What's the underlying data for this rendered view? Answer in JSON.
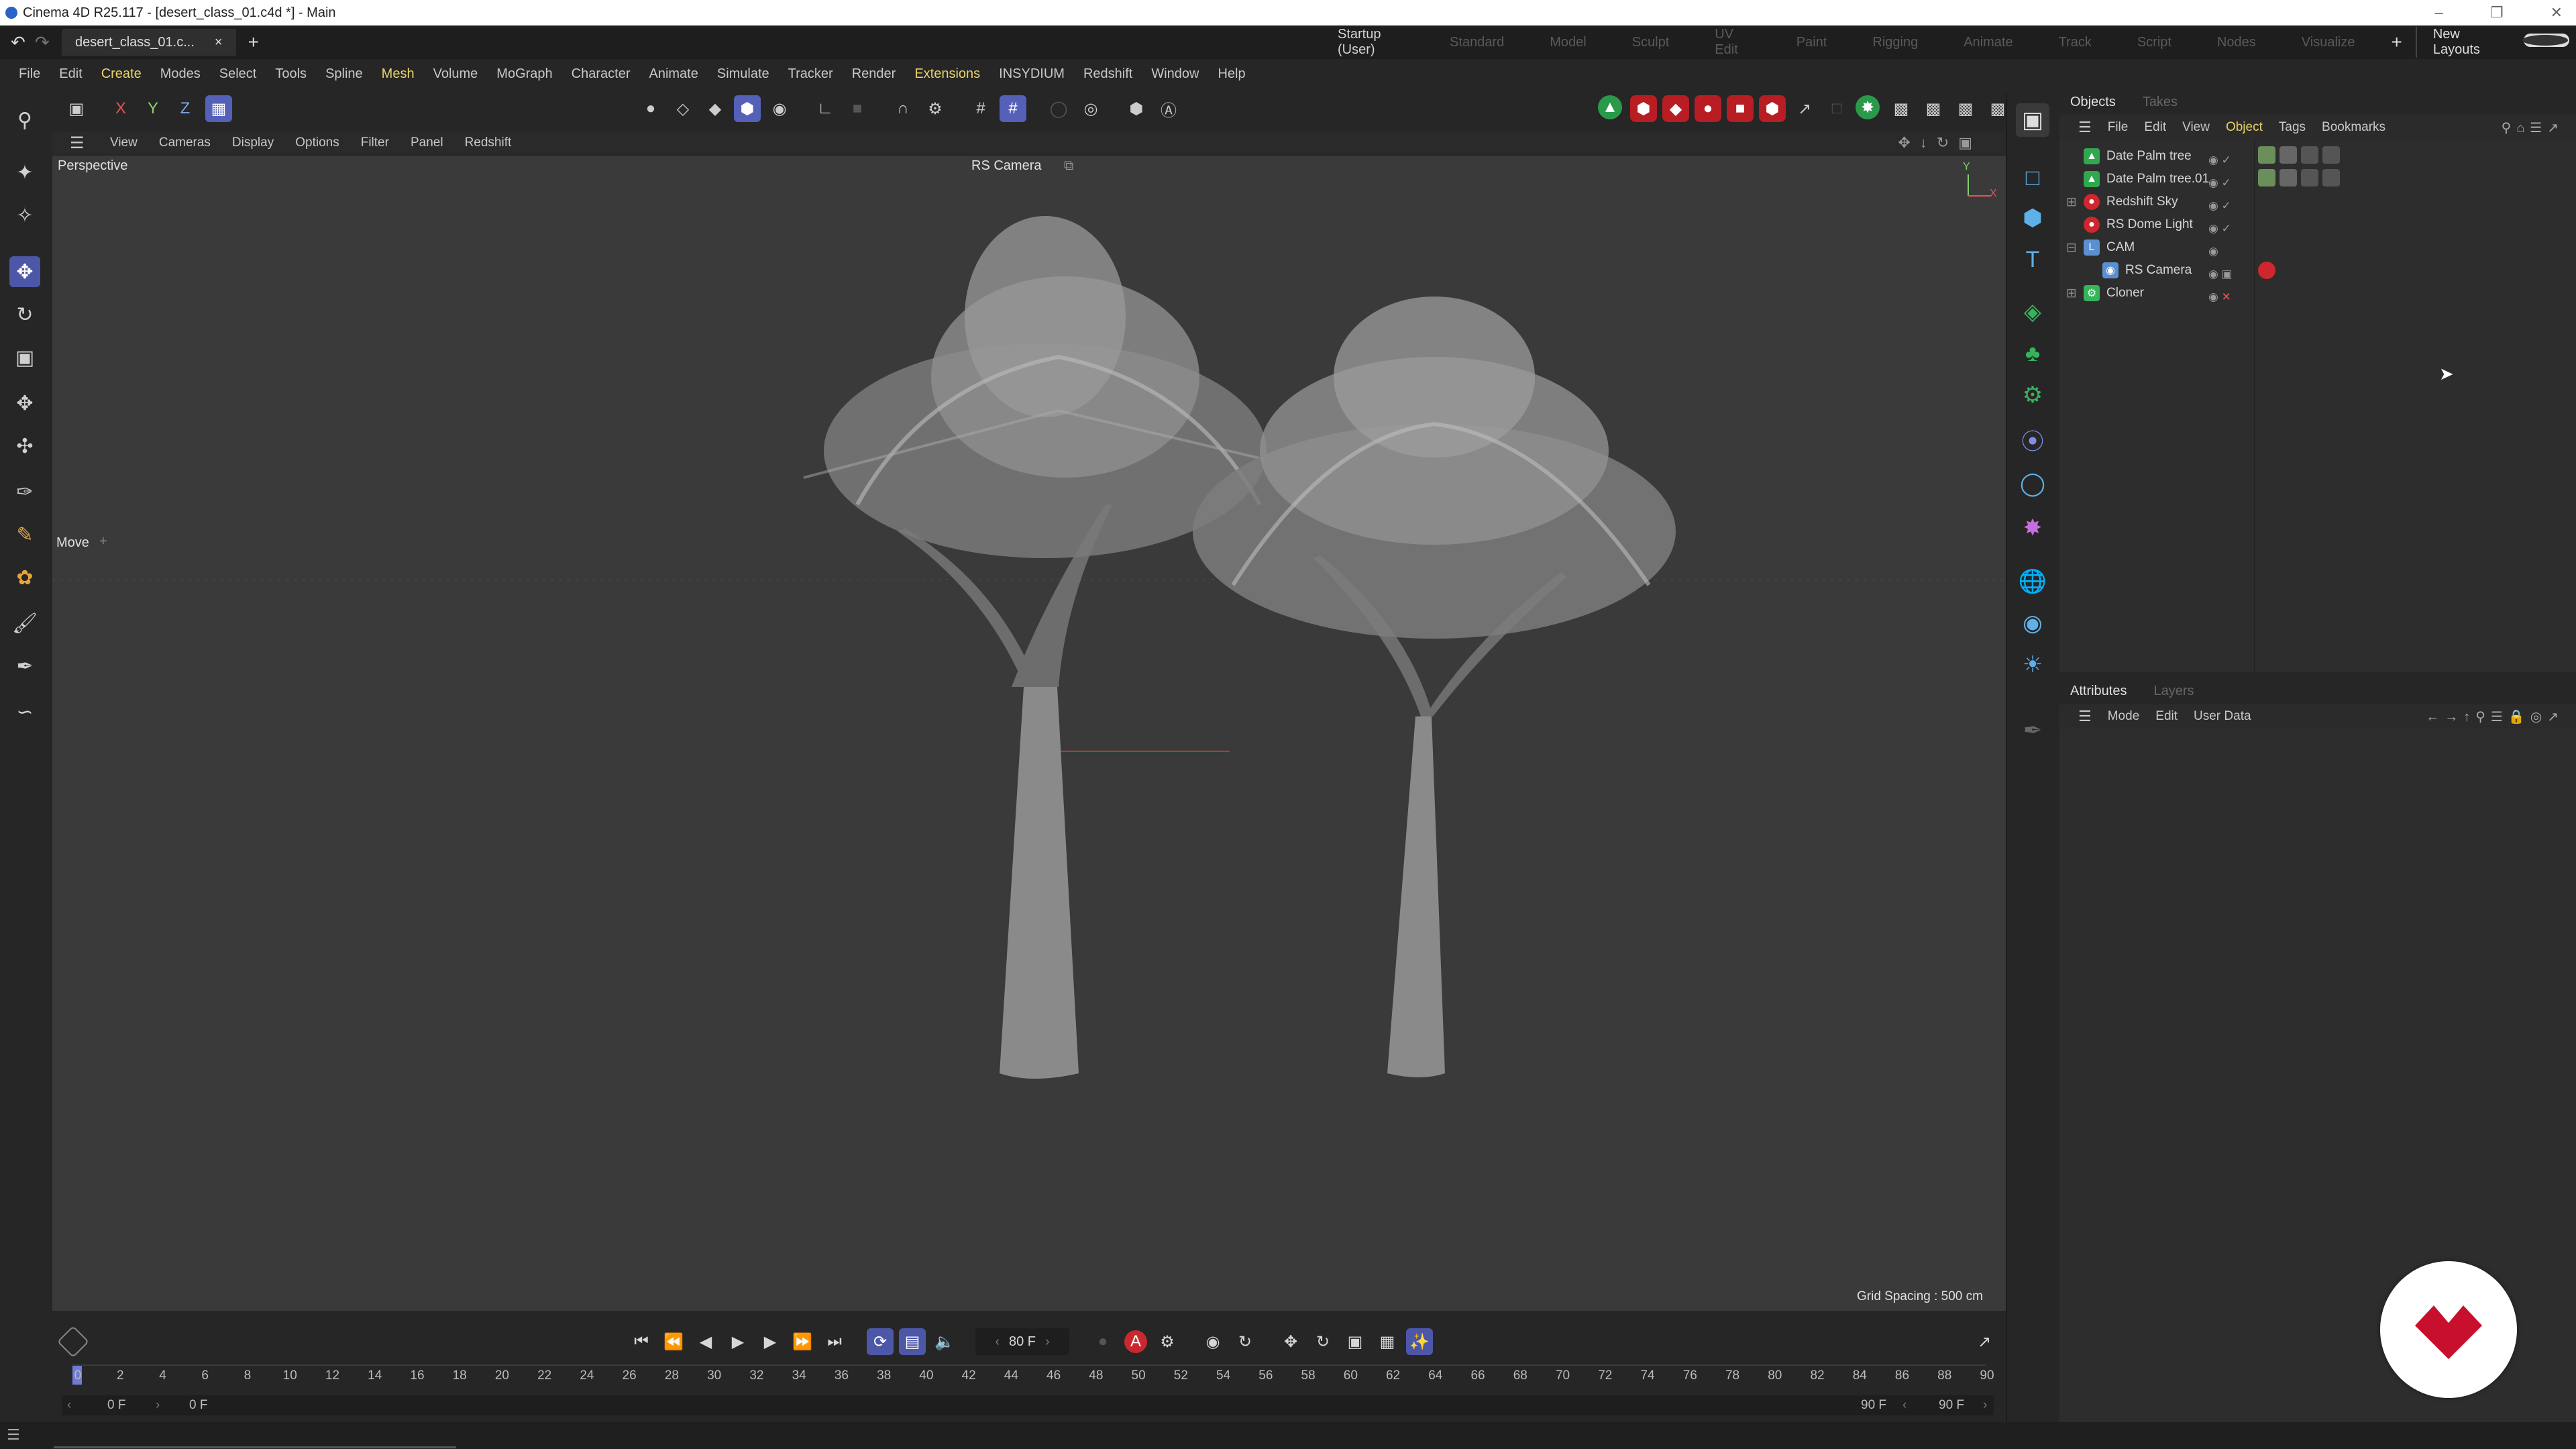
{
  "window": {
    "title": "Cinema 4D R25.117 - [desert_class_01.c4d *] - Main"
  },
  "tabs": {
    "doc_tab": "desert_class_01.c...",
    "close": "×",
    "add": "+"
  },
  "layouts": {
    "items": [
      "Startup (User)",
      "Standard",
      "Model",
      "Sculpt",
      "UV Edit",
      "Paint",
      "Rigging",
      "Animate",
      "Track",
      "Script",
      "Nodes",
      "Visualize"
    ],
    "new_layouts": "New Layouts"
  },
  "menu": [
    "File",
    "Edit",
    "Create",
    "Modes",
    "Select",
    "Tools",
    "Spline",
    "Mesh",
    "Volume",
    "MoGraph",
    "Character",
    "Animate",
    "Simulate",
    "Tracker",
    "Render",
    "Extensions",
    "INSYDIUM",
    "Redshift",
    "Window",
    "Help"
  ],
  "toolbar": {
    "x": "X",
    "y": "Y",
    "z": "Z"
  },
  "viewport_menu": [
    "View",
    "Cameras",
    "Display",
    "Options",
    "Filter",
    "Panel",
    "Redshift"
  ],
  "viewport": {
    "label": "Perspective",
    "camera": "RS Camera",
    "tool": "Move",
    "grid_spacing": "Grid Spacing : 500 cm",
    "axis_y": "Y",
    "axis_x": "X"
  },
  "objects_panel": {
    "tabs": [
      "Objects",
      "Takes"
    ],
    "menu": [
      "File",
      "Edit",
      "View",
      "Object",
      "Tags",
      "Bookmarks"
    ],
    "items": [
      {
        "name": "Date Palm tree",
        "icon": "tree-icon",
        "color": "#2fa84f"
      },
      {
        "name": "Date Palm tree.01",
        "icon": "tree-icon",
        "color": "#2fa84f"
      },
      {
        "name": "Redshift Sky",
        "icon": "redshift-icon",
        "color": "#d0262d"
      },
      {
        "name": "RS Dome Light",
        "icon": "redshift-icon",
        "color": "#d0262d"
      },
      {
        "name": "CAM",
        "icon": "null-icon",
        "color": "#5a8fd0"
      },
      {
        "name": "RS Camera",
        "icon": "camera-icon",
        "color": "#5a8fd0"
      },
      {
        "name": "Cloner",
        "icon": "cloner-icon",
        "color": "#37b35c"
      }
    ]
  },
  "attributes_panel": {
    "tabs": [
      "Attributes",
      "Layers"
    ],
    "menu": [
      "Mode",
      "Edit",
      "User Data"
    ]
  },
  "timeline": {
    "current_frame": "80 F",
    "start": "0 F",
    "start2": "0 F",
    "end": "90 F",
    "end2": "90 F",
    "ticks": [
      "0",
      "2",
      "4",
      "6",
      "8",
      "10",
      "12",
      "14",
      "16",
      "18",
      "20",
      "22",
      "24",
      "26",
      "28",
      "30",
      "32",
      "34",
      "36",
      "38",
      "40",
      "42",
      "44",
      "46",
      "48",
      "50",
      "52",
      "54",
      "56",
      "58",
      "60",
      "62",
      "64",
      "66",
      "68",
      "70",
      "72",
      "74",
      "76",
      "78",
      "80",
      "82",
      "84",
      "86",
      "88",
      "90"
    ]
  },
  "colors": {
    "accent": "#5560b8",
    "viewport_bg": "#3a3a3a",
    "brand_red": "#c8102e"
  }
}
